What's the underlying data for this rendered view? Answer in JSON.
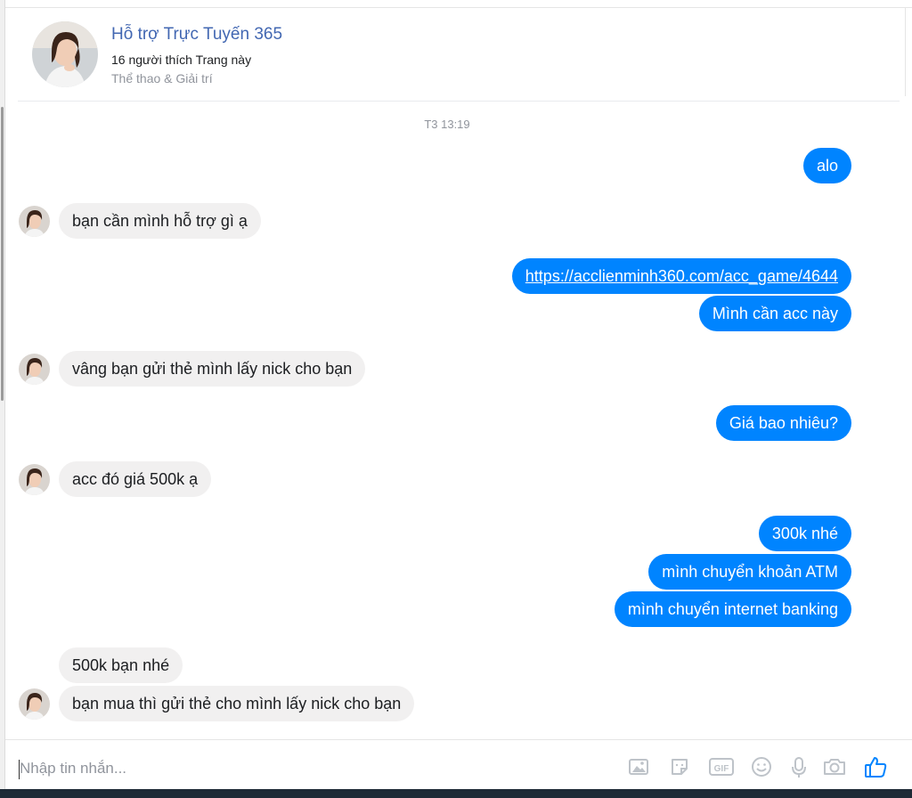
{
  "page": {
    "name": "Hỗ trợ Trực Tuyến 365",
    "likes": "16 người thích Trang này",
    "category": "Thể thao & Giải trí"
  },
  "conversation": {
    "timestamp": "T3 13:19",
    "messages": [
      {
        "from": "me",
        "text": "alo"
      },
      {
        "from": "page",
        "text": "bạn cần mình hỗ trợ gì ạ"
      },
      {
        "from": "me",
        "text": "https://acclienminh360.com/acc_game/4644"
      },
      {
        "from": "me",
        "text": "Mình cần acc này"
      },
      {
        "from": "page",
        "text": "vâng bạn gửi thẻ mình lấy nick cho bạn"
      },
      {
        "from": "me",
        "text": "Giá bao nhiêu?"
      },
      {
        "from": "page",
        "text": "acc đó giá 500k ạ"
      },
      {
        "from": "me",
        "text": "300k nhé"
      },
      {
        "from": "me",
        "text": "mình chuyển khoản ATM"
      },
      {
        "from": "me",
        "text": "mình chuyển internet banking"
      },
      {
        "from": "page",
        "text": "500k bạn nhé"
      },
      {
        "from": "page",
        "text": "bạn mua thì gửi thẻ cho mình lấy nick cho bạn"
      }
    ]
  },
  "composer": {
    "placeholder": "Nhập tin nhắn...",
    "tools": [
      "image-icon",
      "sticker-icon",
      "gif-icon",
      "emoji-icon",
      "microphone-icon",
      "camera-icon",
      "thumbs-up-icon"
    ],
    "gif_label": "GIF"
  },
  "colors": {
    "outgoing": "#0084ff",
    "incoming": "#f1f0f0",
    "page_name": "#4267b2"
  }
}
